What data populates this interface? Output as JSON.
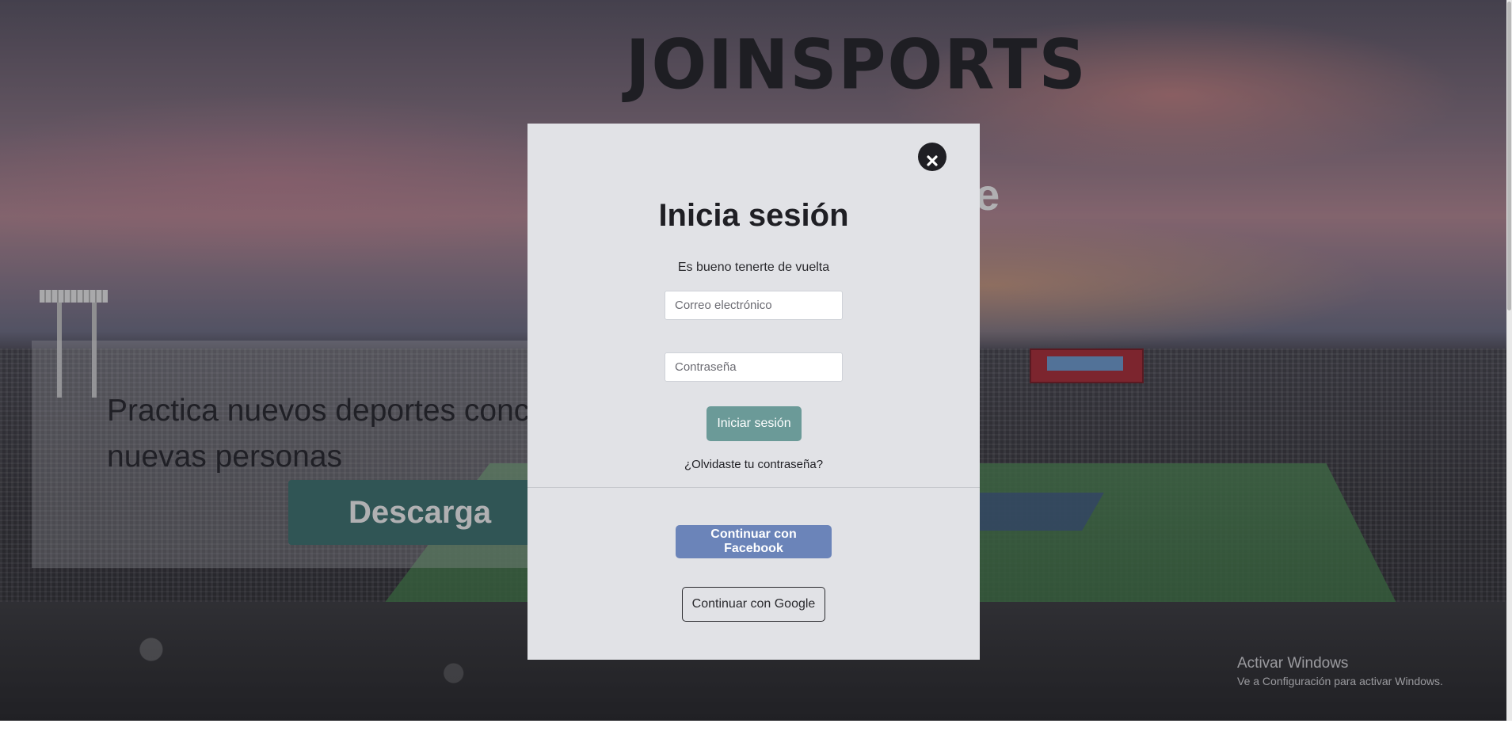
{
  "header": {
    "logo_text": "JOINSPORTS",
    "hero_title_partial": "ce"
  },
  "hero": {
    "tagline": "Practica nuevos deportes conc nuevas personas",
    "download_label": "Descarga"
  },
  "login_modal": {
    "title": "Inicia sesión",
    "subtitle": "Es bueno tenerte de vuelta",
    "email_placeholder": "Correo electrónico",
    "password_placeholder": "Contraseña",
    "submit_label": "Iniciar sesión",
    "forgot_password_label": "¿Olvidaste tu contraseña?",
    "facebook_label": "Continuar con Facebook",
    "google_label": "Continuar con Google",
    "close_icon": "close-circle-icon"
  },
  "system": {
    "activation_title": "Activar Windows",
    "activation_subtitle": "Ve a Configuración para activar Windows."
  },
  "colors": {
    "primary_teal": "#3b7371",
    "login_button": "#6b9a98",
    "facebook_blue": "#6b84b9",
    "modal_background": "#e1e2e6",
    "dark_text": "#1f1f24"
  }
}
